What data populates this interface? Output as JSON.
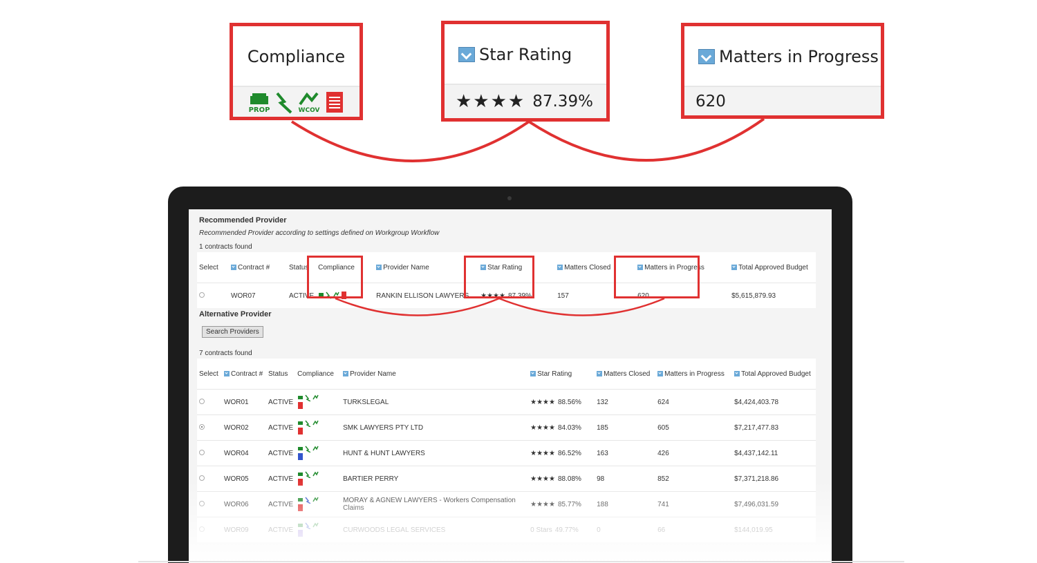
{
  "callouts": {
    "compliance": {
      "title": "Compliance",
      "icons": [
        "prop-icon",
        "lightning-icon",
        "wcov-icon",
        "document-icon"
      ]
    },
    "star_rating": {
      "title": "Star Rating",
      "stars": "★★★★",
      "value": "87.39%"
    },
    "matters": {
      "title": "Matters in Progress",
      "value": "620"
    }
  },
  "recommended": {
    "title": "Recommended Provider",
    "subtitle": "Recommended Provider according to settings defined on Workgroup Workflow",
    "found": "1 contracts found",
    "headers": {
      "select": "Select",
      "contract": "Contract #",
      "status": "Status",
      "compliance": "Compliance",
      "provider": "Provider Name",
      "star": "Star Rating",
      "closed": "Matters Closed",
      "progress": "Matters in Progress",
      "budget": "Total Approved Budget"
    },
    "row": {
      "contract": "WOR07",
      "status": "ACTIVE",
      "provider": "RANKIN ELLISON LAWYERS",
      "stars": "★★★★",
      "rating": "87.39%",
      "closed": "157",
      "progress": "620",
      "budget": "$5,615,879.93"
    }
  },
  "alternative": {
    "title": "Alternative Provider",
    "button": "Search Providers",
    "found": "7 contracts found",
    "headers": {
      "select": "Select",
      "contract": "Contract #",
      "status": "Status",
      "compliance": "Compliance",
      "provider": "Provider Name",
      "star": "Star Rating",
      "closed": "Matters Closed",
      "progress": "Matters in Progress",
      "budget": "Total Approved Budget"
    },
    "rows": [
      {
        "contract": "WOR01",
        "status": "ACTIVE",
        "provider": "TURKSLEGAL",
        "stars": "★★★★",
        "rating": "88.56%",
        "closed": "132",
        "progress": "624",
        "budget": "$4,424,403.78"
      },
      {
        "contract": "WOR02",
        "status": "ACTIVE",
        "provider": "SMK LAWYERS PTY LTD",
        "stars": "★★★★",
        "rating": "84.03%",
        "closed": "185",
        "progress": "605",
        "budget": "$7,217,477.83"
      },
      {
        "contract": "WOR04",
        "status": "ACTIVE",
        "provider": "HUNT & HUNT LAWYERS",
        "stars": "★★★★",
        "rating": "86.52%",
        "closed": "163",
        "progress": "426",
        "budget": "$4,437,142.11"
      },
      {
        "contract": "WOR05",
        "status": "ACTIVE",
        "provider": "BARTIER PERRY",
        "stars": "★★★★",
        "rating": "88.08%",
        "closed": "98",
        "progress": "852",
        "budget": "$7,371,218.86"
      },
      {
        "contract": "WOR06",
        "status": "ACTIVE",
        "provider": "MORAY & AGNEW LAWYERS - Workers Compensation Claims",
        "stars": "★★★★",
        "rating": "85.77%",
        "closed": "188",
        "progress": "741",
        "budget": "$7,496,031.59"
      },
      {
        "contract": "WOR09",
        "status": "ACTIVE",
        "provider": "CURWOODS LEGAL SERVICES",
        "stars": "0 Stars",
        "rating": "49.77%",
        "closed": "0",
        "progress": "66",
        "budget": "$144,019.95"
      }
    ]
  },
  "colors": {
    "accent_red": "#e03131",
    "link_blue": "#3b7bbf",
    "icon_green": "#1f8a2c",
    "icon_red": "#e03131",
    "icon_blue": "#3355cc"
  }
}
